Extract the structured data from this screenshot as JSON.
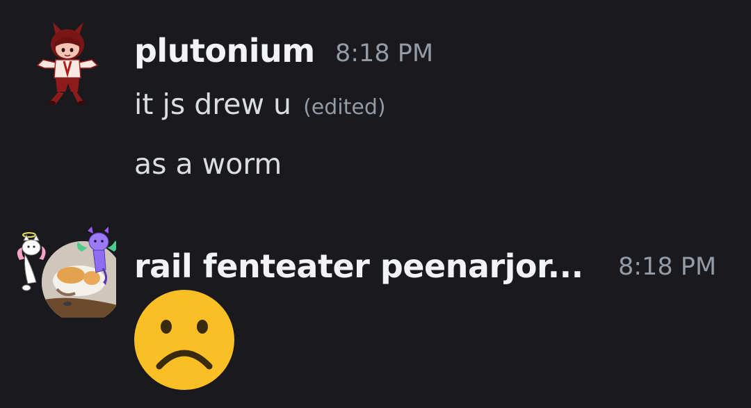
{
  "messages": [
    {
      "author": "plutonium",
      "timestamp": "8:18 PM",
      "lines": [
        {
          "text": "it js drew u",
          "edited": "(edited)"
        },
        {
          "text": "as a worm"
        }
      ]
    },
    {
      "author": "rail fenteater peenarjor...",
      "timestamp": "8:18 PM",
      "emoji": "frowning-face-emoji"
    }
  ],
  "colors": {
    "background": "#1a1a1e",
    "username": "#f2f3f5",
    "message_text": "#dbdee1",
    "muted": "#949ba4",
    "emoji_yellow": "#fbbf26"
  }
}
